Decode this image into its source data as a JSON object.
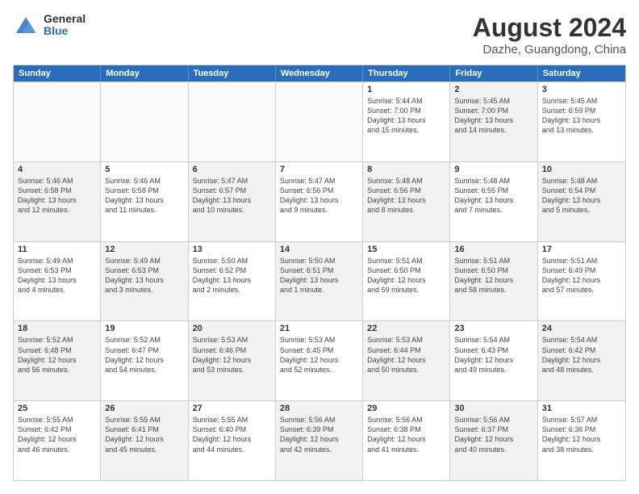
{
  "logo": {
    "general": "General",
    "blue": "Blue"
  },
  "title": "August 2024",
  "subtitle": "Dazhe, Guangdong, China",
  "days": [
    "Sunday",
    "Monday",
    "Tuesday",
    "Wednesday",
    "Thursday",
    "Friday",
    "Saturday"
  ],
  "weeks": [
    [
      {
        "day": "",
        "info": "",
        "shaded": false,
        "empty": true
      },
      {
        "day": "",
        "info": "",
        "shaded": false,
        "empty": true
      },
      {
        "day": "",
        "info": "",
        "shaded": false,
        "empty": true
      },
      {
        "day": "",
        "info": "",
        "shaded": false,
        "empty": true
      },
      {
        "day": "1",
        "info": "Sunrise: 5:44 AM\nSunset: 7:00 PM\nDaylight: 13 hours\nand 15 minutes.",
        "shaded": false,
        "empty": false
      },
      {
        "day": "2",
        "info": "Sunrise: 5:45 AM\nSunset: 7:00 PM\nDaylight: 13 hours\nand 14 minutes.",
        "shaded": true,
        "empty": false
      },
      {
        "day": "3",
        "info": "Sunrise: 5:45 AM\nSunset: 6:59 PM\nDaylight: 13 hours\nand 13 minutes.",
        "shaded": false,
        "empty": false
      }
    ],
    [
      {
        "day": "4",
        "info": "Sunrise: 5:46 AM\nSunset: 6:58 PM\nDaylight: 13 hours\nand 12 minutes.",
        "shaded": true,
        "empty": false
      },
      {
        "day": "5",
        "info": "Sunrise: 5:46 AM\nSunset: 6:58 PM\nDaylight: 13 hours\nand 11 minutes.",
        "shaded": false,
        "empty": false
      },
      {
        "day": "6",
        "info": "Sunrise: 5:47 AM\nSunset: 6:57 PM\nDaylight: 13 hours\nand 10 minutes.",
        "shaded": true,
        "empty": false
      },
      {
        "day": "7",
        "info": "Sunrise: 5:47 AM\nSunset: 6:56 PM\nDaylight: 13 hours\nand 9 minutes.",
        "shaded": false,
        "empty": false
      },
      {
        "day": "8",
        "info": "Sunrise: 5:48 AM\nSunset: 6:56 PM\nDaylight: 13 hours\nand 8 minutes.",
        "shaded": true,
        "empty": false
      },
      {
        "day": "9",
        "info": "Sunrise: 5:48 AM\nSunset: 6:55 PM\nDaylight: 13 hours\nand 7 minutes.",
        "shaded": false,
        "empty": false
      },
      {
        "day": "10",
        "info": "Sunrise: 5:48 AM\nSunset: 6:54 PM\nDaylight: 13 hours\nand 5 minutes.",
        "shaded": true,
        "empty": false
      }
    ],
    [
      {
        "day": "11",
        "info": "Sunrise: 5:49 AM\nSunset: 6:53 PM\nDaylight: 13 hours\nand 4 minutes.",
        "shaded": false,
        "empty": false
      },
      {
        "day": "12",
        "info": "Sunrise: 5:49 AM\nSunset: 6:53 PM\nDaylight: 13 hours\nand 3 minutes.",
        "shaded": true,
        "empty": false
      },
      {
        "day": "13",
        "info": "Sunrise: 5:50 AM\nSunset: 6:52 PM\nDaylight: 13 hours\nand 2 minutes.",
        "shaded": false,
        "empty": false
      },
      {
        "day": "14",
        "info": "Sunrise: 5:50 AM\nSunset: 6:51 PM\nDaylight: 13 hours\nand 1 minute.",
        "shaded": true,
        "empty": false
      },
      {
        "day": "15",
        "info": "Sunrise: 5:51 AM\nSunset: 6:50 PM\nDaylight: 12 hours\nand 59 minutes.",
        "shaded": false,
        "empty": false
      },
      {
        "day": "16",
        "info": "Sunrise: 5:51 AM\nSunset: 6:50 PM\nDaylight: 12 hours\nand 58 minutes.",
        "shaded": true,
        "empty": false
      },
      {
        "day": "17",
        "info": "Sunrise: 5:51 AM\nSunset: 6:49 PM\nDaylight: 12 hours\nand 57 minutes.",
        "shaded": false,
        "empty": false
      }
    ],
    [
      {
        "day": "18",
        "info": "Sunrise: 5:52 AM\nSunset: 6:48 PM\nDaylight: 12 hours\nand 56 minutes.",
        "shaded": true,
        "empty": false
      },
      {
        "day": "19",
        "info": "Sunrise: 5:52 AM\nSunset: 6:47 PM\nDaylight: 12 hours\nand 54 minutes.",
        "shaded": false,
        "empty": false
      },
      {
        "day": "20",
        "info": "Sunrise: 5:53 AM\nSunset: 6:46 PM\nDaylight: 12 hours\nand 53 minutes.",
        "shaded": true,
        "empty": false
      },
      {
        "day": "21",
        "info": "Sunrise: 5:53 AM\nSunset: 6:45 PM\nDaylight: 12 hours\nand 52 minutes.",
        "shaded": false,
        "empty": false
      },
      {
        "day": "22",
        "info": "Sunrise: 5:53 AM\nSunset: 6:44 PM\nDaylight: 12 hours\nand 50 minutes.",
        "shaded": true,
        "empty": false
      },
      {
        "day": "23",
        "info": "Sunrise: 5:54 AM\nSunset: 6:43 PM\nDaylight: 12 hours\nand 49 minutes.",
        "shaded": false,
        "empty": false
      },
      {
        "day": "24",
        "info": "Sunrise: 5:54 AM\nSunset: 6:42 PM\nDaylight: 12 hours\nand 48 minutes.",
        "shaded": true,
        "empty": false
      }
    ],
    [
      {
        "day": "25",
        "info": "Sunrise: 5:55 AM\nSunset: 6:42 PM\nDaylight: 12 hours\nand 46 minutes.",
        "shaded": false,
        "empty": false
      },
      {
        "day": "26",
        "info": "Sunrise: 5:55 AM\nSunset: 6:41 PM\nDaylight: 12 hours\nand 45 minutes.",
        "shaded": true,
        "empty": false
      },
      {
        "day": "27",
        "info": "Sunrise: 5:55 AM\nSunset: 6:40 PM\nDaylight: 12 hours\nand 44 minutes.",
        "shaded": false,
        "empty": false
      },
      {
        "day": "28",
        "info": "Sunrise: 5:56 AM\nSunset: 6:39 PM\nDaylight: 12 hours\nand 42 minutes.",
        "shaded": true,
        "empty": false
      },
      {
        "day": "29",
        "info": "Sunrise: 5:56 AM\nSunset: 6:38 PM\nDaylight: 12 hours\nand 41 minutes.",
        "shaded": false,
        "empty": false
      },
      {
        "day": "30",
        "info": "Sunrise: 5:56 AM\nSunset: 6:37 PM\nDaylight: 12 hours\nand 40 minutes.",
        "shaded": true,
        "empty": false
      },
      {
        "day": "31",
        "info": "Sunrise: 5:57 AM\nSunset: 6:36 PM\nDaylight: 12 hours\nand 38 minutes.",
        "shaded": false,
        "empty": false
      }
    ]
  ]
}
